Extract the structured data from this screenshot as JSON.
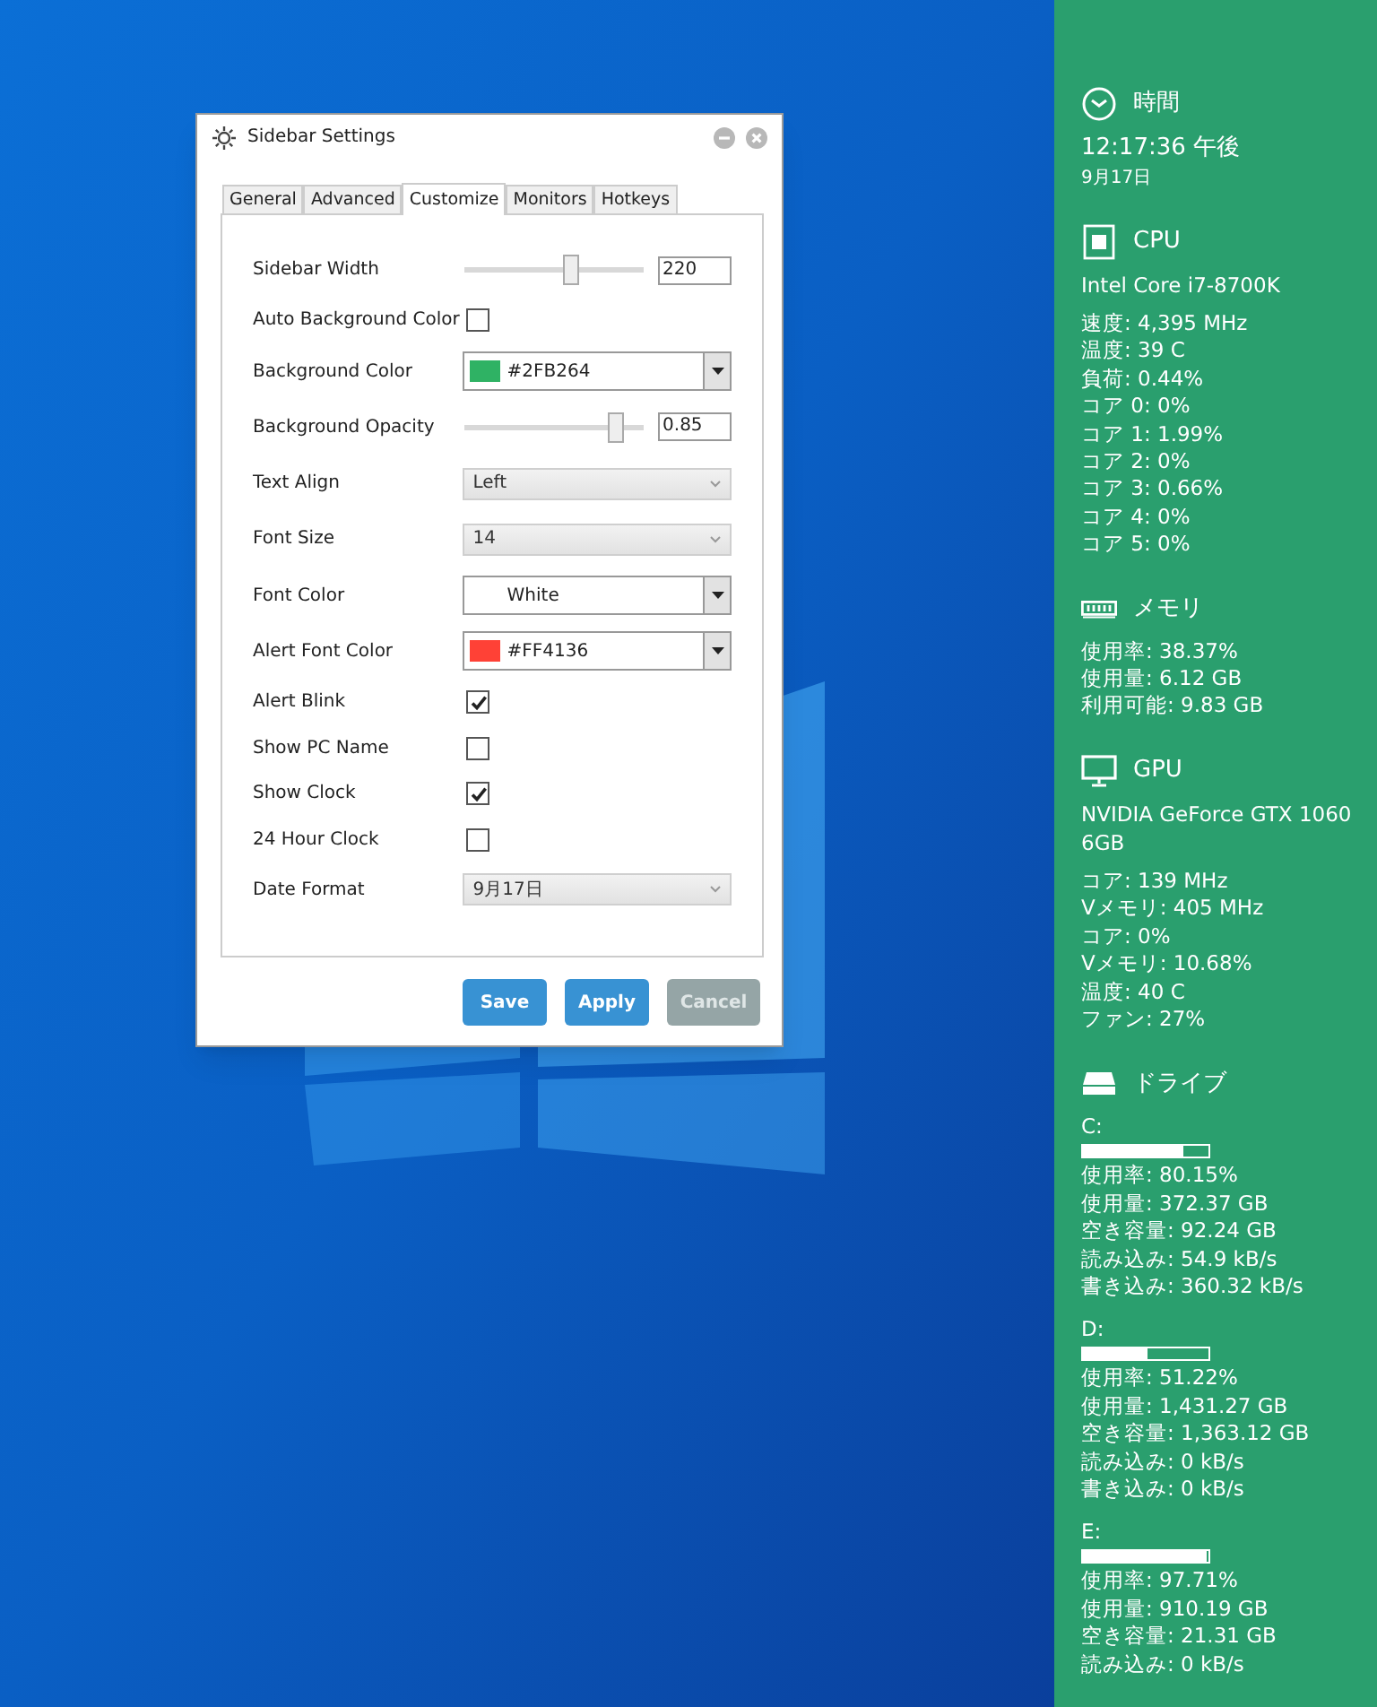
{
  "dialog": {
    "title": "Sidebar Settings",
    "tabs": [
      {
        "label": "General",
        "selected": false
      },
      {
        "label": "Advanced",
        "selected": false
      },
      {
        "label": "Customize",
        "selected": true
      },
      {
        "label": "Monitors",
        "selected": false
      },
      {
        "label": "Hotkeys",
        "selected": false
      }
    ],
    "settings": [
      {
        "kind": "slider",
        "label": "Sidebar Width",
        "level": 0.6,
        "value": "220"
      },
      {
        "kind": "checkbox",
        "label": "Auto Background Color",
        "checked": false
      },
      {
        "kind": "color-select",
        "label": "Background Color",
        "color": "#2fb264",
        "value": "#2FB264"
      },
      {
        "kind": "slider",
        "label": "Background Opacity",
        "level": 0.85,
        "value": "0.85"
      },
      {
        "kind": "select",
        "label": "Text Align",
        "value": "Left"
      },
      {
        "kind": "select",
        "label": "Font Size",
        "value": "14"
      },
      {
        "kind": "color-select",
        "label": "Font Color",
        "value": "White"
      },
      {
        "kind": "color-select",
        "label": "Alert Font Color",
        "color": "#ff4136",
        "value": "#FF4136"
      },
      {
        "kind": "checkbox",
        "label": "Alert Blink",
        "checked": true
      },
      {
        "kind": "checkbox",
        "label": "Show PC Name",
        "checked": false
      },
      {
        "kind": "checkbox",
        "label": "Show Clock",
        "checked": true
      },
      {
        "kind": "checkbox",
        "label": "24 Hour Clock",
        "checked": false
      },
      {
        "kind": "select",
        "label": "Date Format",
        "value": "9月17日"
      }
    ],
    "buttons": [
      {
        "label": "Save",
        "disabled": false
      },
      {
        "label": "Apply",
        "disabled": false
      },
      {
        "label": "Cancel",
        "disabled": true
      }
    ]
  },
  "sidebar": {
    "sections": [
      {
        "kind": "clock",
        "title": "時間",
        "time": "12:17:36 午後",
        "date": "9月17日"
      },
      {
        "kind": "cpu",
        "title": "CPU",
        "model": [
          "Intel Core i7-8700K"
        ],
        "stats": [
          "速度: 4,395 MHz",
          "温度: 39 C",
          "負荷: 0.44%",
          "コア 0: 0%",
          "コア 1: 1.99%",
          "コア 2: 0%",
          "コア 3: 0.66%",
          "コア 4: 0%",
          "コア 5: 0%"
        ]
      },
      {
        "kind": "memory",
        "title": "メモリ",
        "stats": [
          "使用率: 38.37%",
          "使用量: 6.12 GB",
          "利用可能: 9.83 GB"
        ]
      },
      {
        "kind": "monitor",
        "title": "GPU",
        "model": [
          "NVIDIA GeForce GTX 1060",
          "6GB"
        ],
        "stats": [
          "コア: 139 MHz",
          "Vメモリ: 405 MHz",
          "コア: 0%",
          "Vメモリ: 10.68%",
          "温度: 40 C",
          "ファン: 27%"
        ]
      },
      {
        "kind": "drive",
        "title": "ドライブ",
        "drives": [
          {
            "name": "C:",
            "level": 0.8,
            "stats": [
              "使用率: 80.15%",
              "使用量: 372.37 GB",
              "空き容量: 92.24 GB",
              "読み込み: 54.9 kB/s",
              "書き込み: 360.32 kB/s"
            ]
          },
          {
            "name": "D:",
            "level": 0.51,
            "stats": [
              "使用率: 51.22%",
              "使用量: 1,431.27 GB",
              "空き容量: 1,363.12 GB",
              "読み込み: 0 kB/s",
              "書き込み: 0 kB/s"
            ]
          },
          {
            "name": "E:",
            "level": 0.98,
            "stats": [
              "使用率: 97.71%",
              "使用量: 910.19 GB",
              "空き容量: 21.31 GB",
              "読み込み: 0 kB/s"
            ]
          }
        ]
      }
    ]
  }
}
